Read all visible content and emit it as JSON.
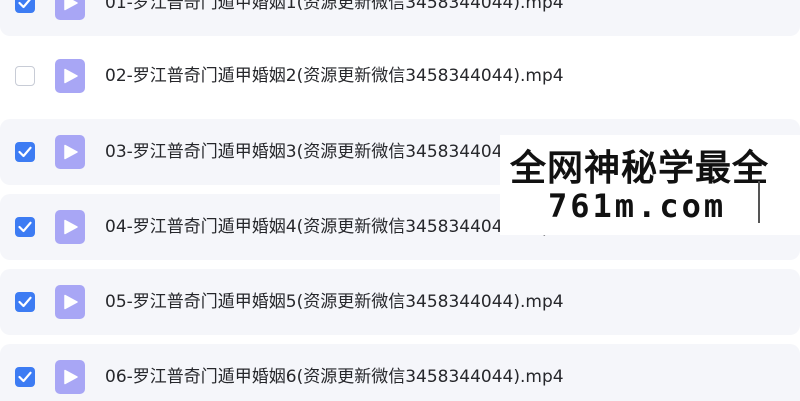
{
  "files": [
    {
      "name": "01-罗江普奇门遁甲婚姻1(资源更新微信3458344044).mp4",
      "checked": true
    },
    {
      "name": "02-罗江普奇门遁甲婚姻2(资源更新微信3458344044).mp4",
      "checked": false
    },
    {
      "name": "03-罗江普奇门遁甲婚姻3(资源更新微信3458344044).mp4",
      "checked": true
    },
    {
      "name": "04-罗江普奇门遁甲婚姻4(资源更新微信3458344044).mp4",
      "checked": true
    },
    {
      "name": "05-罗江普奇门遁甲婚姻5(资源更新微信3458344044).mp4",
      "checked": true
    },
    {
      "name": "06-罗江普奇门遁甲婚姻6(资源更新微信3458344044).mp4",
      "checked": true
    }
  ],
  "icons": {
    "checkbox_checked": "check-icon",
    "file_type": "video-play-icon"
  },
  "colors": {
    "accent": "#3d7cf3",
    "file_icon": "#a8a6f5",
    "row_selected_bg": "#f5f6fa"
  },
  "watermark": {
    "line1": "全网神秘学最全",
    "line2": "761m.com"
  }
}
